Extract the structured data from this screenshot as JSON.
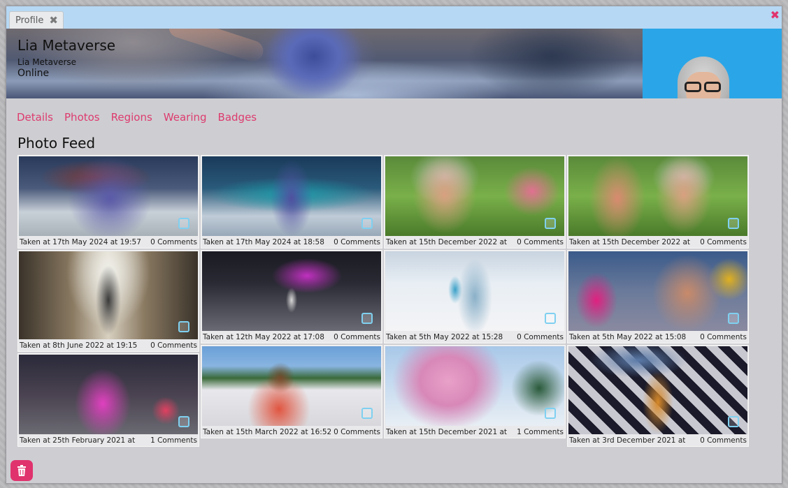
{
  "window": {
    "tab_label": "Profile",
    "tab_close_glyph": "✖",
    "close_glyph": "✖"
  },
  "profile": {
    "display_name": "Lia Metaverse",
    "username": "Lia Metaverse",
    "status": "Online"
  },
  "nav": {
    "items": [
      {
        "label": "Details"
      },
      {
        "label": "Photos"
      },
      {
        "label": "Regions"
      },
      {
        "label": "Wearing"
      },
      {
        "label": "Badges"
      }
    ]
  },
  "feed": {
    "title": "Photo Feed",
    "photos": [
      {
        "taken": "Taken at 17th May 2024 at 19:57",
        "comments": "0 Comments"
      },
      {
        "taken": "Taken at 17th May 2024 at 18:58",
        "comments": "0 Comments"
      },
      {
        "taken": "Taken at 15th December 2022 at",
        "comments": "0 Comments"
      },
      {
        "taken": "Taken at 15th December 2022 at",
        "comments": "0 Comments"
      },
      {
        "taken": "Taken at 8th June 2022 at 19:15",
        "comments": "0 Comments"
      },
      {
        "taken": "Taken at 12th May 2022 at 17:08",
        "comments": "0 Comments"
      },
      {
        "taken": "Taken at 5th May 2022 at 15:28",
        "comments": "0 Comments"
      },
      {
        "taken": "Taken at 5th May 2022 at 15:08",
        "comments": "0 Comments"
      },
      {
        "taken": "Taken at 25th February 2021 at",
        "comments": "1 Comments"
      },
      {
        "taken": "Taken at 15th March 2022 at 16:52",
        "comments": "0 Comments"
      },
      {
        "taken": "Taken at 15th December 2021 at",
        "comments": "1 Comments"
      },
      {
        "taken": "Taken at 3rd December 2021 at",
        "comments": "0 Comments"
      }
    ]
  },
  "colors": {
    "accent": "#dd3b6e",
    "titlebar": "#b6d8f4",
    "avatar_bg": "#2aa6e8",
    "panel": "#ceced2"
  },
  "icons": {
    "delete": "trash-icon",
    "select": "checkbox-icon"
  }
}
